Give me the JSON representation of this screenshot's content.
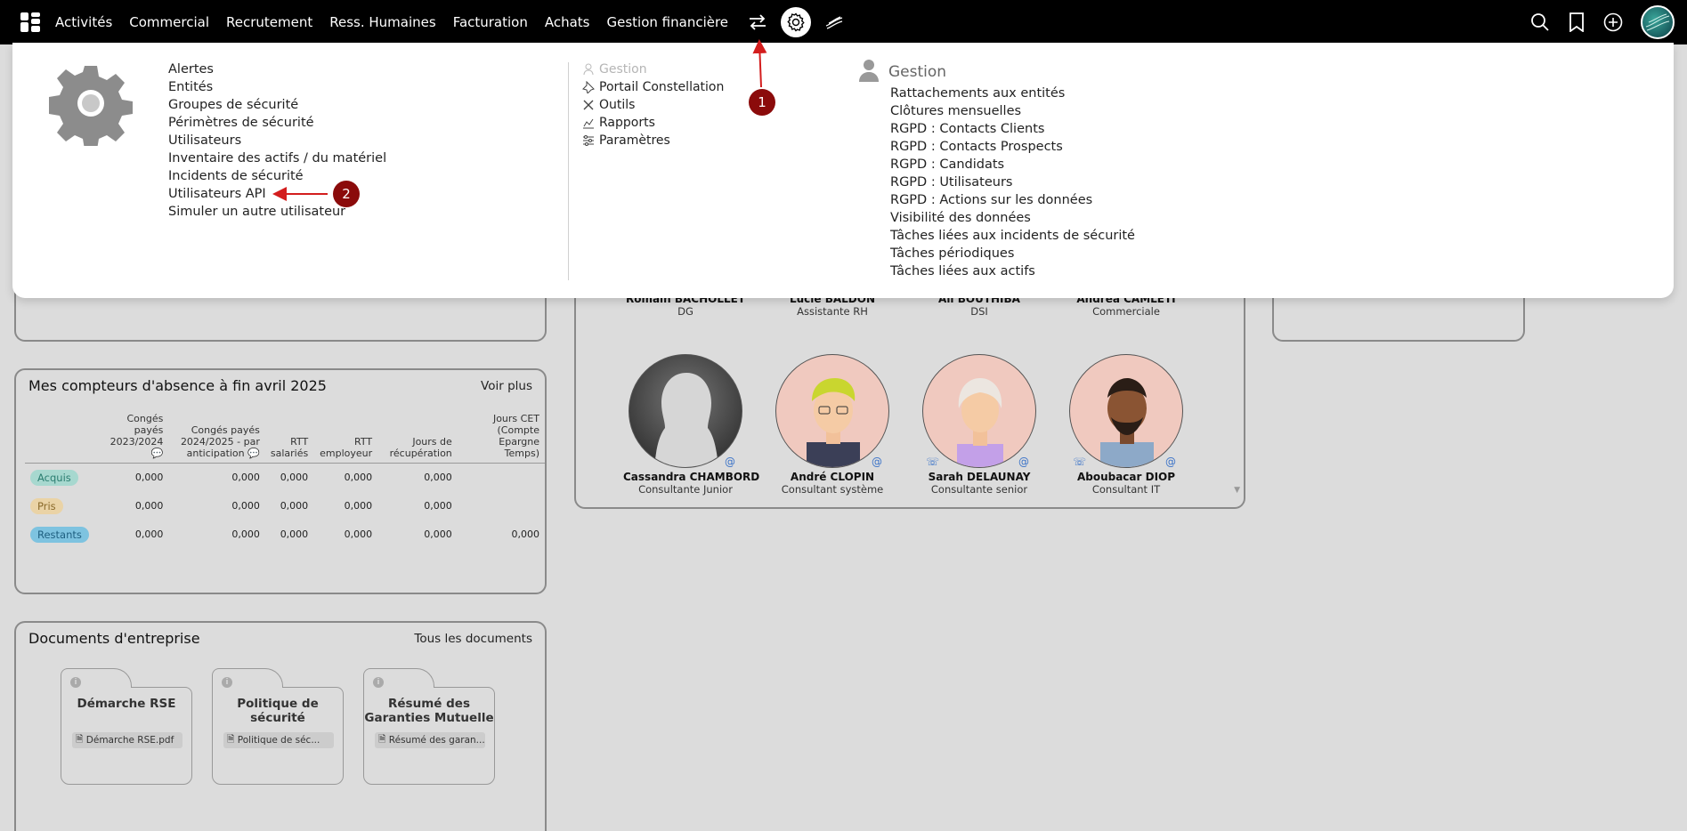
{
  "nav": {
    "items": [
      "Activités",
      "Commercial",
      "Recrutement",
      "Ress. Humaines",
      "Facturation",
      "Achats",
      "Gestion financière"
    ]
  },
  "menu": {
    "col1": [
      "Alertes",
      "Entités",
      "Groupes de sécurité",
      "Périmètres de sécurité",
      "Utilisateurs",
      "Inventaire des actifs / du matériel",
      "Incidents de sécurité",
      "Utilisateurs API",
      "Simuler un autre utilisateur"
    ],
    "col2": [
      {
        "label": "Gestion",
        "icon": "user-icon",
        "disabled": true
      },
      {
        "label": "Portail Constellation",
        "icon": "pin-icon",
        "disabled": false
      },
      {
        "label": "Outils",
        "icon": "tools-icon",
        "disabled": false
      },
      {
        "label": "Rapports",
        "icon": "chart-icon",
        "disabled": false
      },
      {
        "label": "Paramètres",
        "icon": "sliders-icon",
        "disabled": false
      }
    ],
    "col3_title": "Gestion",
    "col3": [
      "Rattachements aux entités",
      "Clôtures mensuelles",
      "RGPD : Contacts Clients",
      "RGPD : Contacts Prospects",
      "RGPD : Candidats",
      "RGPD : Utilisateurs",
      "RGPD : Actions sur les données",
      "Visibilité des données",
      "Tâches liées aux incidents de sécurité",
      "Tâches périodiques",
      "Tâches liées aux actifs"
    ]
  },
  "callouts": {
    "one": "1",
    "two": "2"
  },
  "absences": {
    "title_bold": "Mes compteurs d'absence",
    "title_rest": " à fin avril 2025",
    "link": "Voir plus",
    "headers": [
      "Congés payés 2023/2024",
      "Congés payés 2024/2025 - par anticipation",
      "RTT salariés",
      "RTT employeur",
      "Jours de récupération",
      "Jours CET (Compte Epargne Temps)"
    ],
    "rows": [
      {
        "label": "Acquis",
        "values": [
          "0,000",
          "0,000",
          "0,000",
          "0,000",
          "0,000",
          ""
        ],
        "color": "#a7d8cf"
      },
      {
        "label": "Pris",
        "values": [
          "0,000",
          "0,000",
          "0,000",
          "0,000",
          "0,000",
          ""
        ],
        "color": "#ead3a6"
      },
      {
        "label": "Restants",
        "values": [
          "0,000",
          "0,000",
          "0,000",
          "0,000",
          "0,000",
          "0,000"
        ],
        "color": "#7ec3e0"
      }
    ]
  },
  "documents": {
    "title": "Documents d'entreprise",
    "link": "Tous les documents",
    "items": [
      {
        "name": "Démarche RSE",
        "file": "Démarche RSE.pdf"
      },
      {
        "name": "Politique de sécurité",
        "file": "Politique de séc..."
      },
      {
        "name": "Résumé des Garanties Mutuelle",
        "file": "Résumé des garan..."
      }
    ]
  },
  "team": {
    "row1": [
      {
        "name": "Romain BACHOLLET",
        "role": "DG"
      },
      {
        "name": "Lucie BALDON",
        "role": "Assistante RH"
      },
      {
        "name": "Ali BOUTHIBA",
        "role": "DSI"
      },
      {
        "name": "Andrea CAMLETI",
        "role": "Commerciale"
      }
    ],
    "row2": [
      {
        "name": "Cassandra CHAMBORD",
        "role": "Consultante Junior"
      },
      {
        "name": "André CLOPIN",
        "role": "Consultant système"
      },
      {
        "name": "Sarah DELAUNAY",
        "role": "Consultante senior"
      },
      {
        "name": "Aboubacar DIOP",
        "role": "Consultant IT"
      }
    ]
  }
}
